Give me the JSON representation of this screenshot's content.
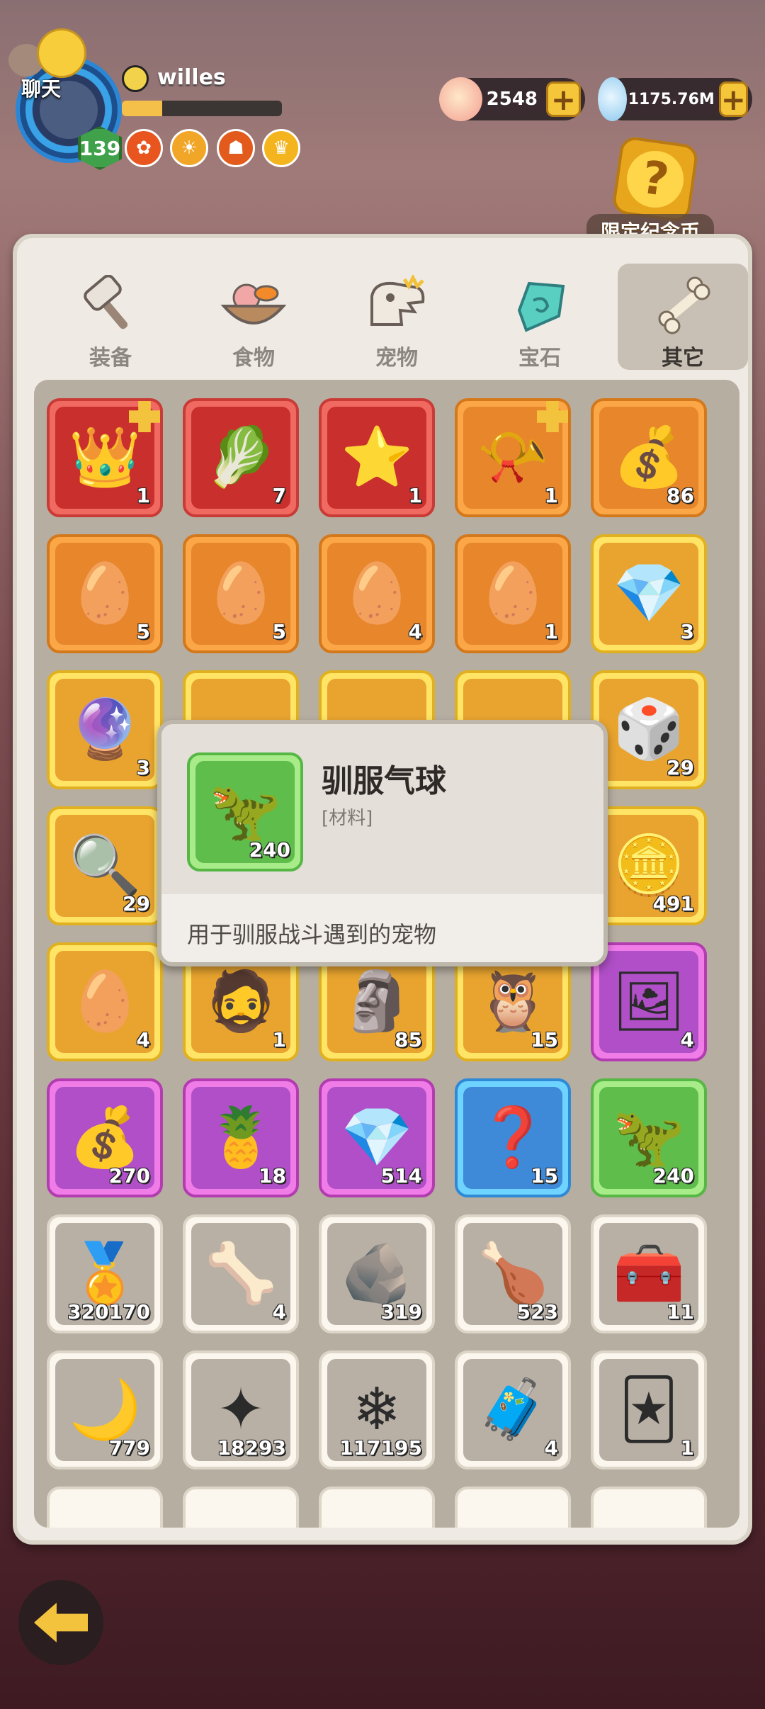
{
  "header": {
    "chat_label": "聊天",
    "username": "willes",
    "level": "139",
    "xp_progress": 0.25,
    "currencies": [
      {
        "name": "shell-currency",
        "value": "2548"
      },
      {
        "name": "gem-currency",
        "value": "1175.76M"
      }
    ],
    "limited_coin_label": "限定纪念币"
  },
  "tabs": [
    {
      "label": "装备",
      "icon": "hammer-icon",
      "active": false
    },
    {
      "label": "食物",
      "icon": "food-bowl-icon",
      "active": false
    },
    {
      "label": "宠物",
      "icon": "dino-skull-icon",
      "active": false
    },
    {
      "label": "宝石",
      "icon": "gem-icon",
      "active": false
    },
    {
      "label": "其它",
      "icon": "bone-icon",
      "active": true
    }
  ],
  "items": [
    {
      "icon": "winged-crown-icon",
      "count": "1",
      "quality": "red",
      "corner": true
    },
    {
      "icon": "green-stone-icon",
      "count": "7",
      "quality": "red"
    },
    {
      "icon": "gold-star-icon",
      "count": "1",
      "quality": "red"
    },
    {
      "icon": "magic-horn-icon",
      "count": "1",
      "quality": "orange",
      "corner": true
    },
    {
      "icon": "lucky-bag-icon",
      "count": "86",
      "quality": "orange"
    },
    {
      "icon": "crystal-egg-icon",
      "count": "5",
      "quality": "orange"
    },
    {
      "icon": "crystal-egg-icon",
      "count": "5",
      "quality": "orange"
    },
    {
      "icon": "crystal-egg-icon",
      "count": "4",
      "quality": "orange"
    },
    {
      "icon": "crystal-egg-icon",
      "count": "1",
      "quality": "orange"
    },
    {
      "icon": "blue-crystal-icon",
      "count": "3",
      "quality": "gold"
    },
    {
      "icon": "purple-crystal-icon",
      "count": "3",
      "quality": "gold"
    },
    {
      "icon": "hidden-item-icon",
      "count": "",
      "quality": "gold"
    },
    {
      "icon": "hidden-item-icon",
      "count": "",
      "quality": "gold"
    },
    {
      "icon": "hidden-item-icon",
      "count": "",
      "quality": "gold"
    },
    {
      "icon": "dice-icon",
      "count": "29",
      "quality": "gold"
    },
    {
      "icon": "magnifier-icon",
      "count": "29",
      "quality": "gold"
    },
    {
      "icon": "hidden-item-icon",
      "count": "",
      "quality": "gold"
    },
    {
      "icon": "hidden-item-icon",
      "count": "",
      "quality": "gold"
    },
    {
      "icon": "hidden-item-icon",
      "count": "",
      "quality": "gold"
    },
    {
      "icon": "gold-coin-icon",
      "count": "491",
      "quality": "gold"
    },
    {
      "icon": "gold-egg-icon",
      "count": "4",
      "quality": "gold"
    },
    {
      "icon": "caveman-icon",
      "count": "1",
      "quality": "gold"
    },
    {
      "icon": "stone-idol-icon",
      "count": "85",
      "quality": "gold"
    },
    {
      "icon": "owl-idol-icon",
      "count": "15",
      "quality": "gold"
    },
    {
      "icon": "portrait-card-icon",
      "count": "4",
      "quality": "purple"
    },
    {
      "icon": "gold-bag-icon",
      "count": "270",
      "quality": "purple"
    },
    {
      "icon": "rainbow-fruit-icon",
      "count": "18",
      "quality": "purple"
    },
    {
      "icon": "pink-crystal-icon",
      "count": "514",
      "quality": "purple"
    },
    {
      "icon": "mystery-box-icon",
      "count": "15",
      "quality": "blue"
    },
    {
      "icon": "taming-balloon-icon",
      "count": "240",
      "quality": "green"
    },
    {
      "icon": "medal-icon",
      "count": "320170",
      "quality": "gray"
    },
    {
      "icon": "dino-fossil-icon",
      "count": "4",
      "quality": "gray"
    },
    {
      "icon": "stone-tablet-icon",
      "count": "319",
      "quality": "gray"
    },
    {
      "icon": "feast-platter-icon",
      "count": "523",
      "quality": "gray"
    },
    {
      "icon": "silver-chest-icon",
      "count": "11",
      "quality": "gray"
    },
    {
      "icon": "moon-icon",
      "count": "779",
      "quality": "gray"
    },
    {
      "icon": "blue-star-icon",
      "count": "18293",
      "quality": "gray"
    },
    {
      "icon": "ice-crystal-icon",
      "count": "117195",
      "quality": "gray"
    },
    {
      "icon": "wood-chest-icon",
      "count": "4",
      "quality": "gray"
    },
    {
      "icon": "character-card-icon",
      "count": "1",
      "quality": "gray"
    }
  ],
  "tooltip": {
    "name": "驯服气球",
    "tag": "[材料]",
    "count": "240",
    "description": "用于驯服战斗遇到的宠物",
    "icon": "taming-balloon-icon"
  }
}
